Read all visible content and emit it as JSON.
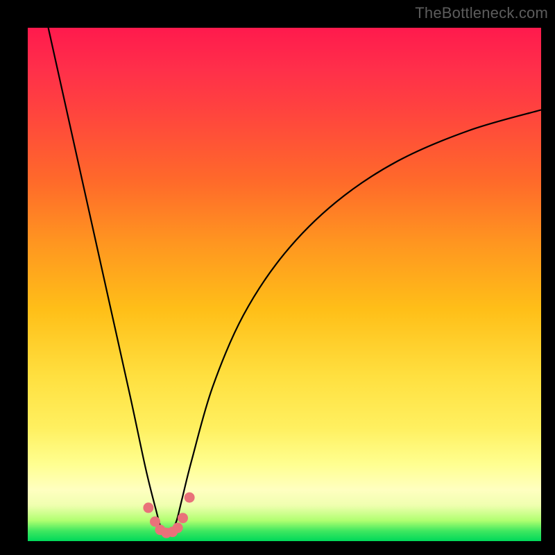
{
  "attribution": "TheBottleneck.com",
  "colors": {
    "frame": "#000000",
    "curve": "#000000",
    "marker": "#e9717a",
    "gradient_top": "#ff1a4d",
    "gradient_bottom": "#00d85a"
  },
  "chart_data": {
    "type": "line",
    "title": "",
    "xlabel": "",
    "ylabel": "",
    "xlim": [
      0,
      100
    ],
    "ylim": [
      0,
      100
    ],
    "grid": false,
    "note": "No axis ticks or numeric labels are visible; values are read as percentage of plot width/height. y=0 at bottom (green), y=100 at top (red). Curve is a V-shaped bottleneck profile with minimum near x≈27.",
    "series": [
      {
        "name": "bottleneck-curve",
        "x": [
          4,
          8,
          12,
          16,
          20,
          23,
          25,
          26,
          27,
          28,
          29,
          30,
          32,
          36,
          42,
          50,
          60,
          72,
          86,
          100
        ],
        "y": [
          100,
          82,
          64,
          46,
          28,
          14,
          6,
          2.5,
          1.5,
          2,
          4,
          8,
          16,
          30,
          44,
          56,
          66,
          74,
          80,
          84
        ]
      }
    ],
    "markers": {
      "name": "highlight-points",
      "x": [
        23.5,
        24.8,
        25.8,
        27.0,
        28.2,
        29.2,
        30.2,
        31.5
      ],
      "y": [
        6.5,
        3.8,
        2.2,
        1.6,
        1.8,
        2.6,
        4.5,
        8.5
      ]
    }
  }
}
